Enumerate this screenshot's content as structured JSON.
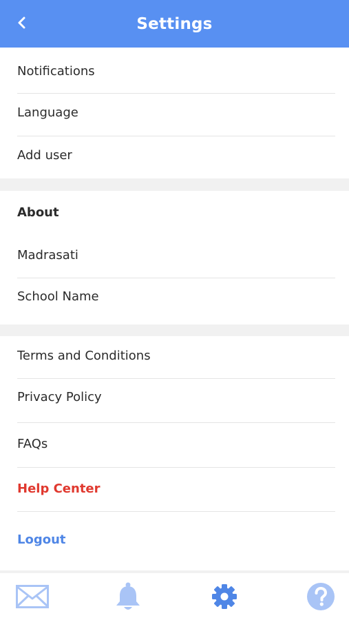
{
  "header": {
    "title": "Settings",
    "back_icon": "chevron-left-icon"
  },
  "sections": {
    "account": [
      "Notifications",
      "Language",
      "Add user"
    ],
    "about": {
      "heading": "About",
      "items": [
        "Madrasati",
        "School Name"
      ]
    },
    "legal": [
      "Terms and Conditions",
      "Privacy Policy",
      "FAQs"
    ],
    "help_center": "Help Center",
    "logout": "Logout"
  },
  "tabbar": {
    "items": [
      {
        "icon": "mail-icon",
        "active": false
      },
      {
        "icon": "bell-icon",
        "active": false
      },
      {
        "icon": "gear-icon",
        "active": true
      },
      {
        "icon": "help-icon",
        "active": false
      }
    ]
  },
  "colors": {
    "header": "#5890f2",
    "help_center": "#e0392f",
    "logout": "#4f86e6",
    "tab_inactive": "#a9c4f6",
    "tab_active": "#4f86e6"
  }
}
